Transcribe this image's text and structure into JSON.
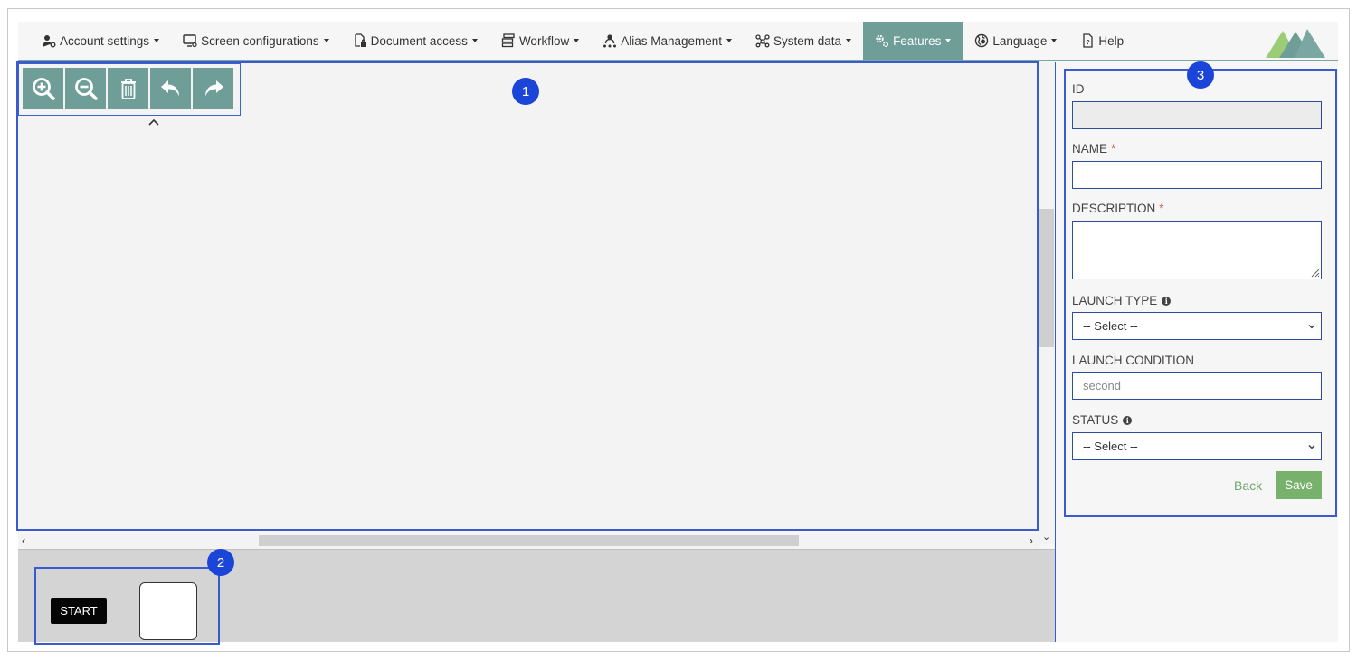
{
  "nav": {
    "items": [
      {
        "label": "Account settings",
        "icon": "user-gear-icon",
        "dropdown": true
      },
      {
        "label": "Screen configurations",
        "icon": "monitor-gear-icon",
        "dropdown": true
      },
      {
        "label": "Document access",
        "icon": "document-lock-icon",
        "dropdown": true
      },
      {
        "label": "Workflow",
        "icon": "workflow-icon",
        "dropdown": true
      },
      {
        "label": "Alias Management",
        "icon": "network-user-icon",
        "dropdown": true
      },
      {
        "label": "System data",
        "icon": "nodes-icon",
        "dropdown": true
      },
      {
        "label": "Features",
        "icon": "gears-icon",
        "dropdown": true,
        "active": true
      },
      {
        "label": "Language",
        "icon": "globe-icon",
        "dropdown": true
      },
      {
        "label": "Help",
        "icon": "help-document-icon",
        "dropdown": false
      }
    ],
    "active_color": "#6f9e99"
  },
  "toolbar": {
    "tools": [
      "zoom-in-icon",
      "zoom-out-icon",
      "trash-icon",
      "undo-icon",
      "redo-icon"
    ]
  },
  "palette": {
    "start_label": "START"
  },
  "form": {
    "id_label": "ID",
    "id_value": "",
    "name_label": "NAME",
    "name_value": "",
    "description_label": "DESCRIPTION",
    "description_value": "",
    "launch_type_label": "LAUNCH TYPE",
    "launch_type_value": "-- Select --",
    "launch_condition_label": "LAUNCH CONDITION",
    "launch_condition_placeholder": "second",
    "status_label": "STATUS",
    "status_value": "-- Select --",
    "required_mark": "*",
    "back_label": "Back",
    "save_label": "Save"
  },
  "badges": {
    "canvas": "1",
    "palette": "2",
    "form": "3"
  },
  "colors": {
    "accent": "#6f9e99",
    "annotation": "#1b44d8",
    "save": "#78b16b",
    "required": "#d9534f"
  }
}
